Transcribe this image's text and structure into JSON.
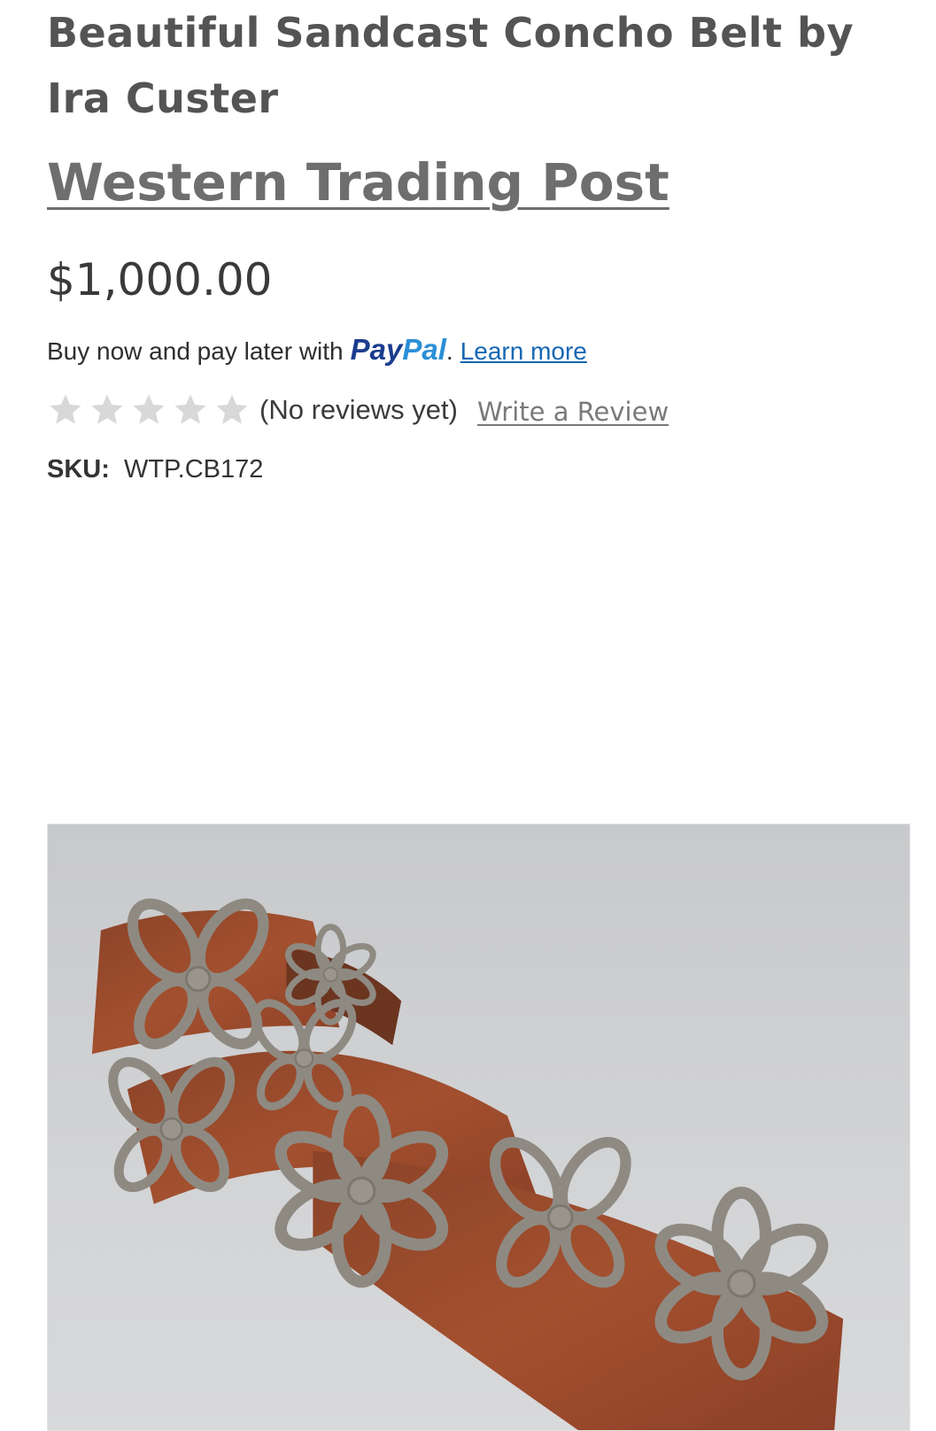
{
  "product": {
    "title": "Beautiful Sandcast Concho Belt by Ira Custer",
    "brand": "Western Trading Post",
    "price": "$1,000.00"
  },
  "paypal": {
    "prefix": "Buy now and pay later with",
    "logo_part1": "Pay",
    "logo_part2": "Pal",
    "suffix": ".",
    "learn_more": "Learn more"
  },
  "reviews": {
    "rating": 0,
    "max_rating": 5,
    "summary": "(No reviews yet)",
    "write_review": "Write a Review"
  },
  "sku": {
    "label": "SKU:",
    "value": "WTP.CB172"
  },
  "image": {
    "icon": "product-photo-concho-belt"
  },
  "colors": {
    "brand_text": "#6e6e6e",
    "link_blue": "#1467b3",
    "paypal_dark": "#1b3d8f",
    "paypal_light": "#2b8fd6",
    "star_empty": "#d8d8d8"
  }
}
